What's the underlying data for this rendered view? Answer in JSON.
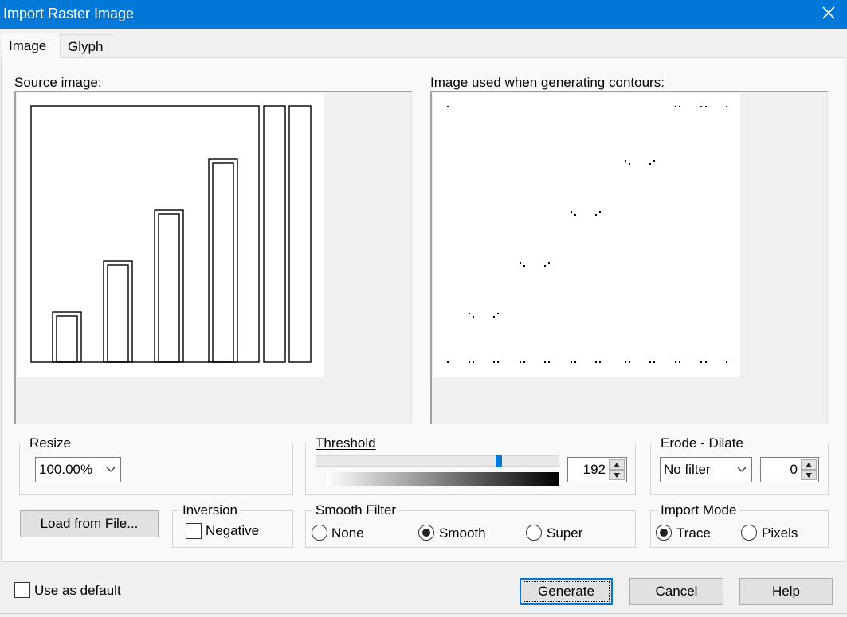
{
  "window": {
    "title": "Import Raster Image"
  },
  "tabs": [
    {
      "label": "Image"
    },
    {
      "label": "Glyph"
    }
  ],
  "source": {
    "label": "Source image:"
  },
  "contours": {
    "label": "Image used when generating contours:"
  },
  "resize": {
    "legend": "Resize",
    "value": "100.00%"
  },
  "threshold": {
    "legend": "Threshold",
    "value": "192",
    "level": 0.75
  },
  "erode_dilate": {
    "legend": "Erode - Dilate",
    "filter": "No filter",
    "amount": "0"
  },
  "load": {
    "label": "Load from File..."
  },
  "inversion": {
    "legend": "Inversion",
    "negative_label": "Negative"
  },
  "smooth_filter": {
    "legend": "Smooth Filter",
    "options": [
      {
        "label": "None"
      },
      {
        "label": "Smooth"
      },
      {
        "label": "Super"
      }
    ],
    "selected": "Smooth"
  },
  "import_mode": {
    "legend": "Import Mode",
    "options": [
      {
        "label": "Trace"
      },
      {
        "label": "Pixels"
      }
    ],
    "selected": "Trace"
  },
  "footer": {
    "use_default_label": "Use as default",
    "generate_label": "Generate",
    "cancel_label": "Cancel",
    "help_label": "Help"
  },
  "colors": {
    "accent": "#0078d7"
  }
}
